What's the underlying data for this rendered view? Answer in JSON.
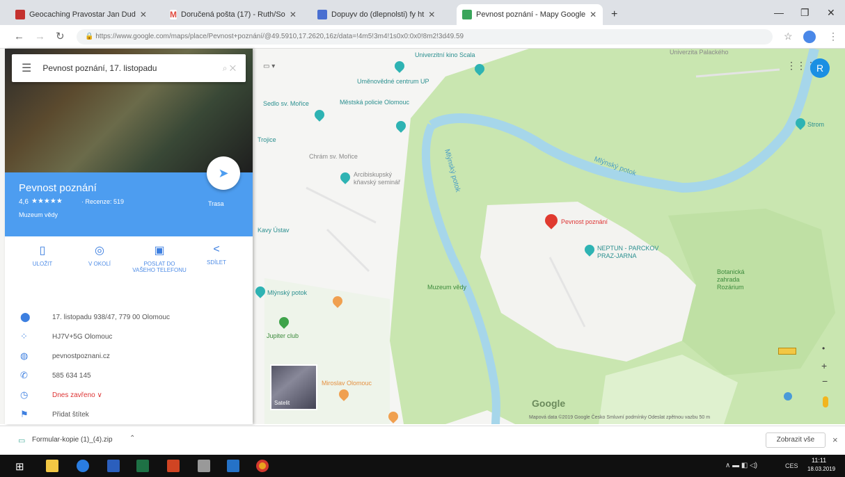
{
  "browser": {
    "tabs": [
      {
        "title": "Geocaching Pravostar Jan Dud",
        "color": "#c4312e"
      },
      {
        "title": "Doručená pošta (17) - Ruth/So",
        "color": "#e04a3f"
      },
      {
        "title": "Dopuyv do (dlepnolsti) fy ht",
        "color": "#4a6fd1"
      },
      {
        "title": "Pevnost poznání - Mapy Google",
        "color": "#3aa55b"
      }
    ],
    "new_tab": "+",
    "url": "https://www.google.com/maps/place/Pevnost+poznání/@49.5910,17.2620,16z/data=!4m5!3m4!1s0x0:0x0!8m2!3d49.59"
  },
  "search": {
    "value": "Pevnost poznání, 17. listopadu"
  },
  "place": {
    "name": "Pevnost poznání",
    "rating": "4,6",
    "stars": "★★★★★",
    "reviews": "· Recenze: 519",
    "category": "Muzeum vědy",
    "route_label": "Trasa"
  },
  "actions": [
    {
      "label": "ULOŽIT",
      "icon": "bookmark-icon"
    },
    {
      "label": "V OKOLÍ",
      "icon": "nearby-icon"
    },
    {
      "label": "POSLAT DO VAŠEHO TELEFONU",
      "icon": "phone-icon"
    },
    {
      "label": "SDÍLET",
      "icon": "share-icon"
    }
  ],
  "details": {
    "address": "17. listopadu 938/47, 779 00 Olomouc",
    "plus_code": "HJ7V+5G Olomouc",
    "website": "pevnostpoznani.cz",
    "phone": "585 634 145",
    "hours": "Dnes zavřeno ∨",
    "add_label": "Přidat štítek"
  },
  "map": {
    "labels": [
      {
        "text": "Univerzitní kino Scala",
        "name": "poi-kino"
      },
      {
        "text": "Uměnovědné centrum UP",
        "name": "poi-umeno"
      },
      {
        "text": "Sedlo sv. Mořice",
        "name": "poi-sedlo"
      },
      {
        "text": "Městská policie Olomouc",
        "name": "poi-policie"
      },
      {
        "text": "Trojice",
        "name": "poi-trojice"
      },
      {
        "text": "Chrám sv. Mořice",
        "name": "poi-chram"
      },
      {
        "text": "Arcibiskupský kňavský seminář",
        "name": "poi-seminar"
      },
      {
        "text": "Mlýnský potok",
        "name": "river-label-1"
      },
      {
        "text": "Mlýnský potok",
        "name": "river-label-2"
      },
      {
        "text": "Pevnost poznání",
        "name": "poi-pevnost"
      },
      {
        "text": "NEPTUN - PARCKOV PRAZ-JARNA",
        "name": "poi-neptun"
      },
      {
        "text": "Botanická zahrada Rozárium",
        "name": "poi-botanicka"
      },
      {
        "text": "Muzeum vědy",
        "name": "poi-muzeum"
      },
      {
        "text": "Mlýnský potok",
        "name": "poi-potok"
      },
      {
        "text": "Jupiter club",
        "name": "poi-jupiter"
      },
      {
        "text": "Kavy Ústav",
        "name": "poi-kavy"
      },
      {
        "text": "Miroslav Olomouc",
        "name": "poi-miroslav"
      },
      {
        "text": "Univerzita Palackého",
        "name": "poi-univerzita"
      },
      {
        "text": "Strom",
        "name": "poi-strom"
      }
    ],
    "streetview_label": "Satelit",
    "logo": "Google",
    "footer": "Mapová data ©2019 Google   Česko   Smluvní podmínky   Odeslat zpětnou vazbu   50 m",
    "zoom_in": "+",
    "zoom_out": "−",
    "avatar_letter": "R"
  },
  "download": {
    "file": "Formular-kopie (1)_(4).zip",
    "show_all": "Zobrazit vše",
    "close": "×"
  },
  "taskbar": {
    "lang": "CES",
    "time": "11:11",
    "date": "18.03.2019"
  }
}
